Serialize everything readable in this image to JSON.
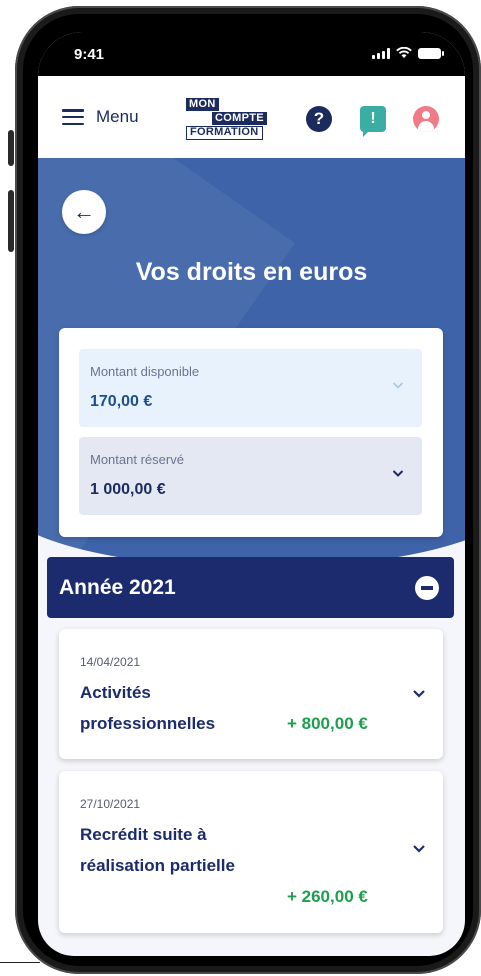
{
  "status_bar": {
    "time": "9:41"
  },
  "header": {
    "menu_label": "Menu",
    "logo": {
      "line1": "MON",
      "line2": "COMPTE",
      "line3": "FORMATION"
    },
    "help_glyph": "?",
    "chat_glyph": "!"
  },
  "hero": {
    "back_glyph": "←",
    "title": "Vos droits en euros"
  },
  "amounts": {
    "available": {
      "label": "Montant disponible",
      "value": "170,00 €"
    },
    "reserved": {
      "label": "Montant réservé",
      "value": "1 000,00 €"
    }
  },
  "year_section": {
    "label": "Année 2021"
  },
  "transactions": [
    {
      "date": "14/04/2021",
      "title": "Activités professionnelles",
      "amount": "+ 800,00 €"
    },
    {
      "date": "27/10/2021",
      "title": "Recrédit suite à réalisation partielle",
      "amount": "+ 260,00 €"
    }
  ],
  "colors": {
    "navy": "#1c2b6e",
    "hero_blue": "#3e63a8",
    "accent_teal": "#3aaea3",
    "accent_pink": "#f07a85",
    "positive_green": "#1e9f4e",
    "available_bg": "#e7f2fd",
    "reserved_bg": "#e4e8f2"
  },
  "icons": {
    "menu": "hamburger-icon",
    "help": "help-icon",
    "chat": "chat-icon",
    "account": "account-icon",
    "back": "back-arrow-icon",
    "expand": "chevron-down-icon",
    "collapse": "minus-circle-icon"
  }
}
